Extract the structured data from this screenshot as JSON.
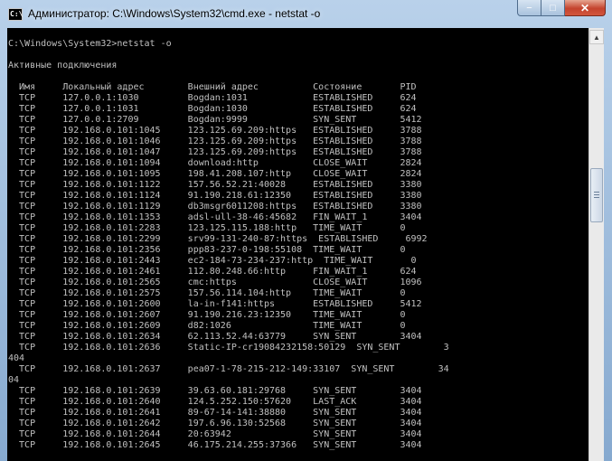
{
  "window": {
    "title": "Администратор: C:\\Windows\\System32\\cmd.exe - netstat  -o",
    "icon_text": "C:\\",
    "controls": {
      "minimize": "−",
      "maximize": "□",
      "close": "✕"
    }
  },
  "scrollbar": {
    "up_arrow": "▲"
  },
  "console": {
    "lines": [
      "",
      "C:\\Windows\\System32>netstat -o",
      "",
      "Активные подключения",
      "",
      "  Имя     Локальный адрес        Внешний адрес          Состояние       PID",
      "  TCP     127.0.0.1:1030         Bogdan:1031            ESTABLISHED     624",
      "  TCP     127.0.0.1:1031         Bogdan:1030            ESTABLISHED     624",
      "  TCP     127.0.0.1:2709         Bogdan:9999            SYN_SENT        5412",
      "  TCP     192.168.0.101:1045     123.125.69.209:https   ESTABLISHED     3788",
      "  TCP     192.168.0.101:1046     123.125.69.209:https   ESTABLISHED     3788",
      "  TCP     192.168.0.101:1047     123.125.69.209:https   ESTABLISHED     3788",
      "  TCP     192.168.0.101:1094     download:http          CLOSE_WAIT      2824",
      "  TCP     192.168.0.101:1095     198.41.208.107:http    CLOSE_WAIT      2824",
      "  TCP     192.168.0.101:1122     157.56.52.21:40028     ESTABLISHED     3380",
      "  TCP     192.168.0.101:1124     91.190.218.61:12350    ESTABLISHED     3380",
      "  TCP     192.168.0.101:1129     db3msgr6011208:https   ESTABLISHED     3380",
      "  TCP     192.168.0.101:1353     adsl-ull-38-46:45682   FIN_WAIT_1      3404",
      "  TCP     192.168.0.101:2283     123.125.115.188:http   TIME_WAIT       0",
      "  TCP     192.168.0.101:2299     srv99-131-240-87:https  ESTABLISHED     6992",
      "  TCP     192.168.0.101:2356     ppp83-237-0-198:55108  TIME_WAIT       0",
      "  TCP     192.168.0.101:2443     ec2-184-73-234-237:http  TIME_WAIT       0",
      "  TCP     192.168.0.101:2461     112.80.248.66:http     FIN_WAIT_1      624",
      "  TCP     192.168.0.101:2565     cmc:https              CLOSE_WAIT      1096",
      "  TCP     192.168.0.101:2575     157.56.114.104:http    TIME_WAIT       0",
      "  TCP     192.168.0.101:2600     la-in-f141:https       ESTABLISHED     5412",
      "  TCP     192.168.0.101:2607     91.190.216.23:12350    TIME_WAIT       0",
      "  TCP     192.168.0.101:2609     d82:1026               TIME_WAIT       0",
      "  TCP     192.168.0.101:2634     62.113.52.44:63779     SYN_SENT        3404",
      "  TCP     192.168.0.101:2636     Static-IP-cr19084232158:50129  SYN_SENT        3",
      "404",
      "  TCP     192.168.0.101:2637     pea07-1-78-215-212-149:33107  SYN_SENT        34",
      "04",
      "  TCP     192.168.0.101:2639     39.63.60.181:29768     SYN_SENT        3404",
      "  TCP     192.168.0.101:2640     124.5.252.150:57620    LAST_ACK        3404",
      "  TCP     192.168.0.101:2641     89-67-14-141:38880     SYN_SENT        3404",
      "  TCP     192.168.0.101:2642     197.6.96.130:52568     SYN_SENT        3404",
      "  TCP     192.168.0.101:2644     20:63942               SYN_SENT        3404",
      "  TCP     192.168.0.101:2645     46.175.214.255:37366   SYN_SENT        3404"
    ]
  }
}
